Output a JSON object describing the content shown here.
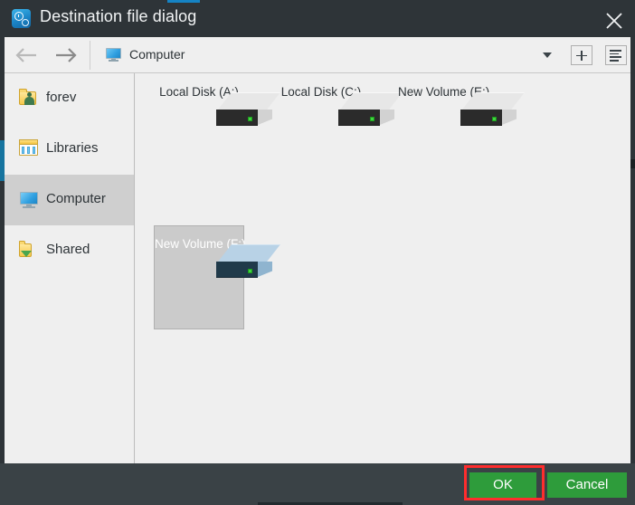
{
  "window": {
    "title": "Destination file dialog",
    "app_icon": "clock-gear-icon",
    "close_icon": "close-icon",
    "accent_color": "#1583c4"
  },
  "navbar": {
    "back_icon": "arrow-left-icon",
    "forward_icon": "arrow-right-icon",
    "location_icon": "computer-monitor-icon",
    "location": "Computer",
    "dropdown_icon": "chevron-down-icon",
    "new_folder_icon": "plus-icon",
    "view_mode_icon": "list-view-icon"
  },
  "sidebar": {
    "items": [
      {
        "label": "forev",
        "icon": "user-folder-icon",
        "selected": false
      },
      {
        "label": "Libraries",
        "icon": "libraries-icon",
        "selected": false
      },
      {
        "label": "Computer",
        "icon": "computer-monitor-icon",
        "selected": true
      },
      {
        "label": "Shared",
        "icon": "shared-folder-icon",
        "selected": false
      }
    ]
  },
  "files": {
    "items": [
      {
        "label": "Local Disk (A:)",
        "icon": "hard-drive-icon",
        "selected": false
      },
      {
        "label": "Local Disk (C:)",
        "icon": "hard-drive-icon",
        "selected": false
      },
      {
        "label": "New Volume (E:)",
        "icon": "hard-drive-icon",
        "selected": false
      },
      {
        "label": "New Volume (F:)",
        "icon": "hard-drive-icon",
        "selected": true
      }
    ]
  },
  "footer": {
    "ok_label": "OK",
    "cancel_label": "Cancel",
    "button_color": "#2e9c3b",
    "highlight_color": "#ff2d2d"
  }
}
